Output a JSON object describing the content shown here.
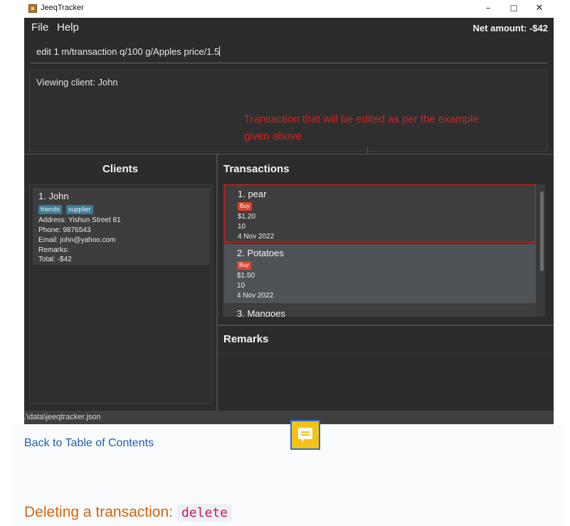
{
  "window": {
    "title": "JeeqTracker",
    "minimize_label": "–",
    "maximize_label": "☐",
    "close_label": "✕"
  },
  "menu": {
    "file": "File",
    "help": "Help",
    "net_amount": "Net amount: -$42"
  },
  "command": {
    "value": "edit 1 m/transaction q/100 g/Apples price/1.5"
  },
  "result": {
    "text": "Viewing client: John"
  },
  "annotation": {
    "text": "Transaction that will be edited as per the example given above"
  },
  "clients": {
    "title": "Clients",
    "items": [
      {
        "name": "1.  John",
        "tags": [
          "friends",
          "supplier"
        ],
        "address": "Address: Yishun Street 81",
        "phone": "Phone: 9876543",
        "email": "Email: john@yahoo.com",
        "remarks": "Remarks:",
        "total": "Total: -$42"
      }
    ]
  },
  "transactions": {
    "title": "Transactions",
    "items": [
      {
        "name": "1.  pear",
        "type": "Buy",
        "price": "$1.20",
        "quantity": "10",
        "date": "4 Nov 2022"
      },
      {
        "name": "2.  Potatoes",
        "type": "Buy",
        "price": "$1.50",
        "quantity": "10",
        "date": "4 Nov 2022"
      },
      {
        "name": "3.  Mangoes"
      }
    ]
  },
  "remarks": {
    "title": "Remarks"
  },
  "status": {
    "path": ".\\data\\jeeqtracker.json"
  },
  "page": {
    "back_link": "Back to Table of Contents",
    "section_heading": "Deleting a transaction:",
    "section_code": "delete"
  },
  "colors": {
    "annotation": "#d6201e",
    "tag": "#3f7c96",
    "buy_badge": "#d9442e",
    "heading": "#d2660f",
    "link": "#1d5fb0"
  }
}
